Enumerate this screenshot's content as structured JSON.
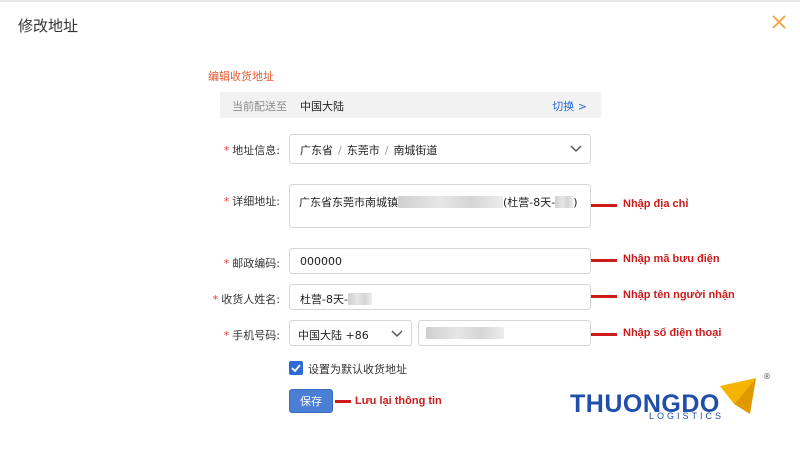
{
  "dialog": {
    "title": "修改地址",
    "close_icon": "close-icon"
  },
  "form": {
    "section_title": "编辑收货地址",
    "destination": {
      "label": "当前配送至",
      "value": "中国大陆",
      "switch_label": "切换 >"
    },
    "region": {
      "label": "地址信息:",
      "province": "广东省",
      "city": "东莞市",
      "district": "南城街道",
      "separator": "/"
    },
    "detail": {
      "label": "详细地址:",
      "value_prefix": "广东省东莞市南城镇",
      "value_suffix": "(杜营-8天-",
      "value_end": ")"
    },
    "postal": {
      "label": "邮政编码:",
      "value": "000000"
    },
    "recipient": {
      "label": "收货人姓名:",
      "value": "杜营-8天-"
    },
    "phone": {
      "label": "手机号码:",
      "country": "中国大陆 +86"
    },
    "default_checkbox": {
      "label": "设置为默认收货地址",
      "checked": true
    },
    "save_label": "保存"
  },
  "annotations": {
    "address": "Nhập địa chỉ",
    "postal": "Nhập mã bưu điện",
    "recipient": "Nhập tên người  nhận",
    "phone": "Nhập số điện thoại",
    "save": "Lưu lại thông tin"
  },
  "logo": {
    "main": "THUONGDO",
    "sub": "LOGISTICS",
    "reg": "®"
  },
  "colors": {
    "accent_orange": "#e4572e",
    "link_blue": "#2d6bd6",
    "button_blue": "#4b7fd6",
    "required_red": "#e4393c",
    "annotation_red": "#cc1b1b",
    "logo_blue": "#1f4fa8",
    "logo_gold": "#f5b400"
  }
}
